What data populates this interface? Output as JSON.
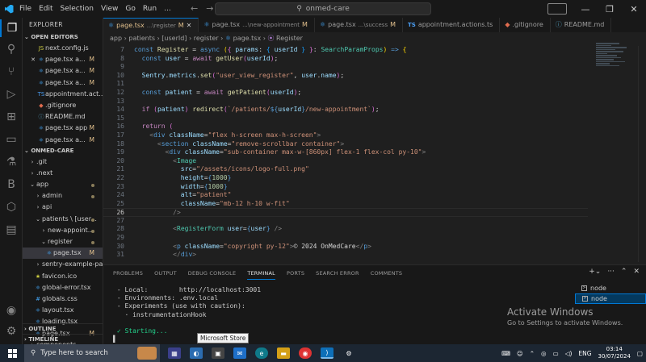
{
  "menu": [
    "File",
    "Edit",
    "Selection",
    "View",
    "Go",
    "Run",
    "..."
  ],
  "search": {
    "text": "onmed-care"
  },
  "tabs": [
    {
      "name": "page.tsx",
      "dir": "...\\register",
      "mark": "M",
      "active": true
    },
    {
      "name": "page.tsx",
      "dir": "...\\new-appointment",
      "mark": "M"
    },
    {
      "name": "page.tsx",
      "dir": "...\\success",
      "mark": "M"
    },
    {
      "name": "appointment.actions.ts",
      "dir": "",
      "mark": ""
    },
    {
      "name": ".gitignore",
      "dir": "",
      "mark": ""
    },
    {
      "name": "README.md",
      "dir": "",
      "mark": ""
    }
  ],
  "breadcrumb": [
    "app",
    "patients",
    "[userId]",
    "register",
    "page.tsx",
    "Register"
  ],
  "explorer": {
    "title": "EXPLORER",
    "open_editors_title": "OPEN EDITORS",
    "open_editors": [
      {
        "icon": "js",
        "label": "next.config.js",
        "mark": ""
      },
      {
        "icon": "react",
        "label": "page.tsx a...",
        "mark": "M",
        "close": true
      },
      {
        "icon": "react",
        "label": "page.tsx a...",
        "mark": "M"
      },
      {
        "icon": "react",
        "label": "page.tsx a...",
        "mark": "M"
      },
      {
        "icon": "ts",
        "label": "appointment.act...",
        "mark": ""
      },
      {
        "icon": "git",
        "label": ".gitignore",
        "mark": ""
      },
      {
        "icon": "info",
        "label": "README.md",
        "mark": ""
      },
      {
        "icon": "react",
        "label": "page.tsx app",
        "mark": "M"
      },
      {
        "icon": "react",
        "label": "page.tsx a...",
        "mark": "M"
      }
    ],
    "project_title": "ONMED-CARE",
    "tree": [
      {
        "label": ".git",
        "indent": 1,
        "folder": true
      },
      {
        "label": ".next",
        "indent": 1,
        "folder": true
      },
      {
        "label": "app",
        "indent": 1,
        "folder": true,
        "open": true,
        "dot": true
      },
      {
        "label": "admin",
        "indent": 2,
        "folder": true,
        "dot": true
      },
      {
        "label": "api",
        "indent": 2,
        "folder": true
      },
      {
        "label": "patients \\ [user...",
        "indent": 2,
        "folder": true,
        "open": true,
        "dot": true
      },
      {
        "label": "new-appoint...",
        "indent": 3,
        "folder": true,
        "dot": true
      },
      {
        "label": "register",
        "indent": 3,
        "folder": true,
        "open": true,
        "dot": true
      },
      {
        "label": "page.tsx",
        "indent": 4,
        "icon": "react",
        "mark": "M",
        "selected": true
      },
      {
        "label": "sentry-example-page",
        "indent": 2,
        "folder": true
      },
      {
        "label": "favicon.ico",
        "indent": 2,
        "icon": "img"
      },
      {
        "label": "global-error.tsx",
        "indent": 2,
        "icon": "react"
      },
      {
        "label": "globals.css",
        "indent": 2,
        "icon": "css"
      },
      {
        "label": "layout.tsx",
        "indent": 2,
        "icon": "react"
      },
      {
        "label": "loading.tsx",
        "indent": 2,
        "icon": "react"
      },
      {
        "label": "page.tsx",
        "indent": 2,
        "icon": "react",
        "mark": "M"
      },
      {
        "label": "components",
        "indent": 1,
        "folder": true
      }
    ],
    "outline": "OUTLINE",
    "timeline": "TIMELINE"
  },
  "code": [
    {
      "n": "7",
      "html": "<span class='k'>const</span> <span class='f'>Register</span> <span class='w'>=</span> <span class='k'>async</span> <span class='p'>(</span><span class='p2'>{</span> <span class='v'>params</span><span class='w'>:</span> <span class='p3'>{</span> <span class='v'>userId</span> <span class='p3'>}</span> <span class='p2'>}</span><span class='w'>:</span> <span class='t'>SearchParamProps</span><span class='p'>)</span> <span class='k'>=&gt;</span> <span class='p'>{</span>"
    },
    {
      "n": "8",
      "html": "  <span class='k'>const</span> <span class='v'>user</span> <span class='w'>=</span> <span class='kc'>await</span> <span class='f'>getUser</span><span class='p2'>(</span><span class='v'>userId</span><span class='p2'>)</span><span class='w'>;</span>"
    },
    {
      "n": "9",
      "html": ""
    },
    {
      "n": "10",
      "html": "  <span class='v'>Sentry</span><span class='w'>.</span><span class='v'>metrics</span><span class='w'>.</span><span class='f'>set</span><span class='p2'>(</span><span class='s'>\"user_view_register\"</span><span class='w'>,</span> <span class='v'>user</span><span class='w'>.</span><span class='v'>name</span><span class='p2'>)</span><span class='w'>;</span>"
    },
    {
      "n": "11",
      "html": ""
    },
    {
      "n": "12",
      "html": "  <span class='k'>const</span> <span class='v'>patient</span> <span class='w'>=</span> <span class='kc'>await</span> <span class='f'>getPatient</span><span class='p2'>(</span><span class='v'>userId</span><span class='p2'>)</span><span class='w'>;</span>"
    },
    {
      "n": "13",
      "html": ""
    },
    {
      "n": "14",
      "html": "  <span class='kc'>if</span> <span class='p2'>(</span><span class='v'>patient</span><span class='p2'>)</span> <span class='f'>redirect</span><span class='p2'>(</span><span class='s'>`/patients/</span><span class='k'>${</span><span class='v'>userId</span><span class='k'>}</span><span class='s'>/new-appointment`</span><span class='p2'>)</span><span class='w'>;</span>"
    },
    {
      "n": "15",
      "html": ""
    },
    {
      "n": "16",
      "html": "  <span class='kc'>return</span> <span class='p2'>(</span>"
    },
    {
      "n": "17",
      "html": "    <span class='g'>&lt;</span><span class='k'>div</span> <span class='v'>className</span><span class='w'>=</span><span class='s'>\"flex h-screen max-h-screen\"</span><span class='g'>&gt;</span>"
    },
    {
      "n": "18",
      "html": "      <span class='g'>&lt;</span><span class='k'>section</span> <span class='v'>className</span><span class='w'>=</span><span class='s'>\"remove-scrollbar container\"</span><span class='g'>&gt;</span>"
    },
    {
      "n": "19",
      "html": "        <span class='g'>&lt;</span><span class='k'>div</span> <span class='v'>className</span><span class='w'>=</span><span class='s'>\"sub-container max-w-[860px] flex-1 flex-col py-10\"</span><span class='g'>&gt;</span>"
    },
    {
      "n": "20",
      "html": "          <span class='g'>&lt;</span><span class='t'>Image</span>"
    },
    {
      "n": "21",
      "html": "            <span class='v'>src</span><span class='w'>=</span><span class='s'>\"/assets/icons/logo-full.png\"</span>"
    },
    {
      "n": "22",
      "html": "            <span class='v'>height</span><span class='w'>=</span><span class='k'>{</span><span class='n'>1000</span><span class='k'>}</span>"
    },
    {
      "n": "23",
      "html": "            <span class='v'>width</span><span class='w'>=</span><span class='k'>{</span><span class='n'>1000</span><span class='k'>}</span>"
    },
    {
      "n": "24",
      "html": "            <span class='v'>alt</span><span class='w'>=</span><span class='s'>\"patient\"</span>"
    },
    {
      "n": "25",
      "html": "            <span class='v'>className</span><span class='w'>=</span><span class='s'>\"mb-12 h-10 w-fit\"</span>"
    },
    {
      "n": "26",
      "html": "          <span class='g'>/&gt;</span>",
      "current": true
    },
    {
      "n": "27",
      "html": ""
    },
    {
      "n": "28",
      "html": "          <span class='g'>&lt;</span><span class='t'>RegisterForm</span> <span class='v'>user</span><span class='w'>=</span><span class='k'>{</span><span class='v'>user</span><span class='k'>}</span> <span class='g'>/&gt;</span>"
    },
    {
      "n": "29",
      "html": ""
    },
    {
      "n": "30",
      "html": "          <span class='g'>&lt;</span><span class='k'>p</span> <span class='v'>className</span><span class='w'>=</span><span class='s'>\"copyright py-12\"</span><span class='g'>&gt;</span><span class='w'>© 2024 OnMedCare</span><span class='g'>&lt;/</span><span class='k'>p</span><span class='g'>&gt;</span>"
    },
    {
      "n": "31",
      "html": "          <span class='g'>&lt;/</span><span class='k'>div</span><span class='g'>&gt;</span>"
    }
  ],
  "panel": {
    "tabs": [
      "PROBLEMS",
      "OUTPUT",
      "DEBUG CONSOLE",
      "TERMINAL",
      "PORTS",
      "SEARCH ERROR",
      "COMMENTS"
    ],
    "active_tab": "TERMINAL",
    "terminal_lines": [
      " - Local:        http://localhost:3001",
      " - Environments: .env.local",
      " - Experiments (use with caution):",
      "   · instrumentationHook",
      "",
      " ✓ Starting...",
      "▌"
    ],
    "terminals": [
      {
        "label": "node",
        "selected": false
      },
      {
        "label": "node",
        "selected": true
      }
    ]
  },
  "tooltip": "Microsoft Store",
  "activation": {
    "title": "Activate Windows",
    "subtitle": "Go to Settings to activate Windows."
  },
  "taskbar": {
    "search_placeholder": "Type here to search",
    "tray_lang": "ENG",
    "time": "03:14",
    "date": "30/07/2024"
  }
}
